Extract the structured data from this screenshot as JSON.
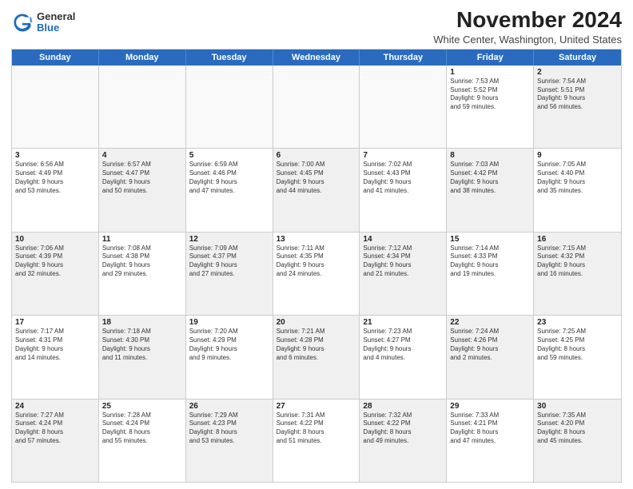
{
  "header": {
    "logo": {
      "general": "General",
      "blue": "Blue"
    },
    "title": "November 2024",
    "subtitle": "White Center, Washington, United States"
  },
  "days": [
    "Sunday",
    "Monday",
    "Tuesday",
    "Wednesday",
    "Thursday",
    "Friday",
    "Saturday"
  ],
  "rows": [
    [
      {
        "day": "",
        "empty": true
      },
      {
        "day": "",
        "empty": true
      },
      {
        "day": "",
        "empty": true
      },
      {
        "day": "",
        "empty": true
      },
      {
        "day": "",
        "empty": true
      },
      {
        "day": "1",
        "lines": [
          "Sunrise: 7:53 AM",
          "Sunset: 5:52 PM",
          "Daylight: 9 hours",
          "and 59 minutes."
        ]
      },
      {
        "day": "2",
        "lines": [
          "Sunrise: 7:54 AM",
          "Sunset: 5:51 PM",
          "Daylight: 9 hours",
          "and 56 minutes."
        ],
        "shaded": true
      }
    ],
    [
      {
        "day": "3",
        "lines": [
          "Sunrise: 6:56 AM",
          "Sunset: 4:49 PM",
          "Daylight: 9 hours",
          "and 53 minutes."
        ]
      },
      {
        "day": "4",
        "lines": [
          "Sunrise: 6:57 AM",
          "Sunset: 4:47 PM",
          "Daylight: 9 hours",
          "and 50 minutes."
        ],
        "shaded": true
      },
      {
        "day": "5",
        "lines": [
          "Sunrise: 6:59 AM",
          "Sunset: 4:46 PM",
          "Daylight: 9 hours",
          "and 47 minutes."
        ]
      },
      {
        "day": "6",
        "lines": [
          "Sunrise: 7:00 AM",
          "Sunset: 4:45 PM",
          "Daylight: 9 hours",
          "and 44 minutes."
        ],
        "shaded": true
      },
      {
        "day": "7",
        "lines": [
          "Sunrise: 7:02 AM",
          "Sunset: 4:43 PM",
          "Daylight: 9 hours",
          "and 41 minutes."
        ]
      },
      {
        "day": "8",
        "lines": [
          "Sunrise: 7:03 AM",
          "Sunset: 4:42 PM",
          "Daylight: 9 hours",
          "and 38 minutes."
        ],
        "shaded": true
      },
      {
        "day": "9",
        "lines": [
          "Sunrise: 7:05 AM",
          "Sunset: 4:40 PM",
          "Daylight: 9 hours",
          "and 35 minutes."
        ]
      }
    ],
    [
      {
        "day": "10",
        "lines": [
          "Sunrise: 7:06 AM",
          "Sunset: 4:39 PM",
          "Daylight: 9 hours",
          "and 32 minutes."
        ],
        "shaded": true
      },
      {
        "day": "11",
        "lines": [
          "Sunrise: 7:08 AM",
          "Sunset: 4:38 PM",
          "Daylight: 9 hours",
          "and 29 minutes."
        ]
      },
      {
        "day": "12",
        "lines": [
          "Sunrise: 7:09 AM",
          "Sunset: 4:37 PM",
          "Daylight: 9 hours",
          "and 27 minutes."
        ],
        "shaded": true
      },
      {
        "day": "13",
        "lines": [
          "Sunrise: 7:11 AM",
          "Sunset: 4:35 PM",
          "Daylight: 9 hours",
          "and 24 minutes."
        ]
      },
      {
        "day": "14",
        "lines": [
          "Sunrise: 7:12 AM",
          "Sunset: 4:34 PM",
          "Daylight: 9 hours",
          "and 21 minutes."
        ],
        "shaded": true
      },
      {
        "day": "15",
        "lines": [
          "Sunrise: 7:14 AM",
          "Sunset: 4:33 PM",
          "Daylight: 9 hours",
          "and 19 minutes."
        ]
      },
      {
        "day": "16",
        "lines": [
          "Sunrise: 7:15 AM",
          "Sunset: 4:32 PM",
          "Daylight: 9 hours",
          "and 16 minutes."
        ],
        "shaded": true
      }
    ],
    [
      {
        "day": "17",
        "lines": [
          "Sunrise: 7:17 AM",
          "Sunset: 4:31 PM",
          "Daylight: 9 hours",
          "and 14 minutes."
        ]
      },
      {
        "day": "18",
        "lines": [
          "Sunrise: 7:18 AM",
          "Sunset: 4:30 PM",
          "Daylight: 9 hours",
          "and 11 minutes."
        ],
        "shaded": true
      },
      {
        "day": "19",
        "lines": [
          "Sunrise: 7:20 AM",
          "Sunset: 4:29 PM",
          "Daylight: 9 hours",
          "and 9 minutes."
        ]
      },
      {
        "day": "20",
        "lines": [
          "Sunrise: 7:21 AM",
          "Sunset: 4:28 PM",
          "Daylight: 9 hours",
          "and 6 minutes."
        ],
        "shaded": true
      },
      {
        "day": "21",
        "lines": [
          "Sunrise: 7:23 AM",
          "Sunset: 4:27 PM",
          "Daylight: 9 hours",
          "and 4 minutes."
        ]
      },
      {
        "day": "22",
        "lines": [
          "Sunrise: 7:24 AM",
          "Sunset: 4:26 PM",
          "Daylight: 9 hours",
          "and 2 minutes."
        ],
        "shaded": true
      },
      {
        "day": "23",
        "lines": [
          "Sunrise: 7:25 AM",
          "Sunset: 4:25 PM",
          "Daylight: 8 hours",
          "and 59 minutes."
        ]
      }
    ],
    [
      {
        "day": "24",
        "lines": [
          "Sunrise: 7:27 AM",
          "Sunset: 4:24 PM",
          "Daylight: 8 hours",
          "and 57 minutes."
        ],
        "shaded": true
      },
      {
        "day": "25",
        "lines": [
          "Sunrise: 7:28 AM",
          "Sunset: 4:24 PM",
          "Daylight: 8 hours",
          "and 55 minutes."
        ]
      },
      {
        "day": "26",
        "lines": [
          "Sunrise: 7:29 AM",
          "Sunset: 4:23 PM",
          "Daylight: 8 hours",
          "and 53 minutes."
        ],
        "shaded": true
      },
      {
        "day": "27",
        "lines": [
          "Sunrise: 7:31 AM",
          "Sunset: 4:22 PM",
          "Daylight: 8 hours",
          "and 51 minutes."
        ]
      },
      {
        "day": "28",
        "lines": [
          "Sunrise: 7:32 AM",
          "Sunset: 4:22 PM",
          "Daylight: 8 hours",
          "and 49 minutes."
        ],
        "shaded": true
      },
      {
        "day": "29",
        "lines": [
          "Sunrise: 7:33 AM",
          "Sunset: 4:21 PM",
          "Daylight: 8 hours",
          "and 47 minutes."
        ]
      },
      {
        "day": "30",
        "lines": [
          "Sunrise: 7:35 AM",
          "Sunset: 4:20 PM",
          "Daylight: 8 hours",
          "and 45 minutes."
        ],
        "shaded": true
      }
    ]
  ]
}
